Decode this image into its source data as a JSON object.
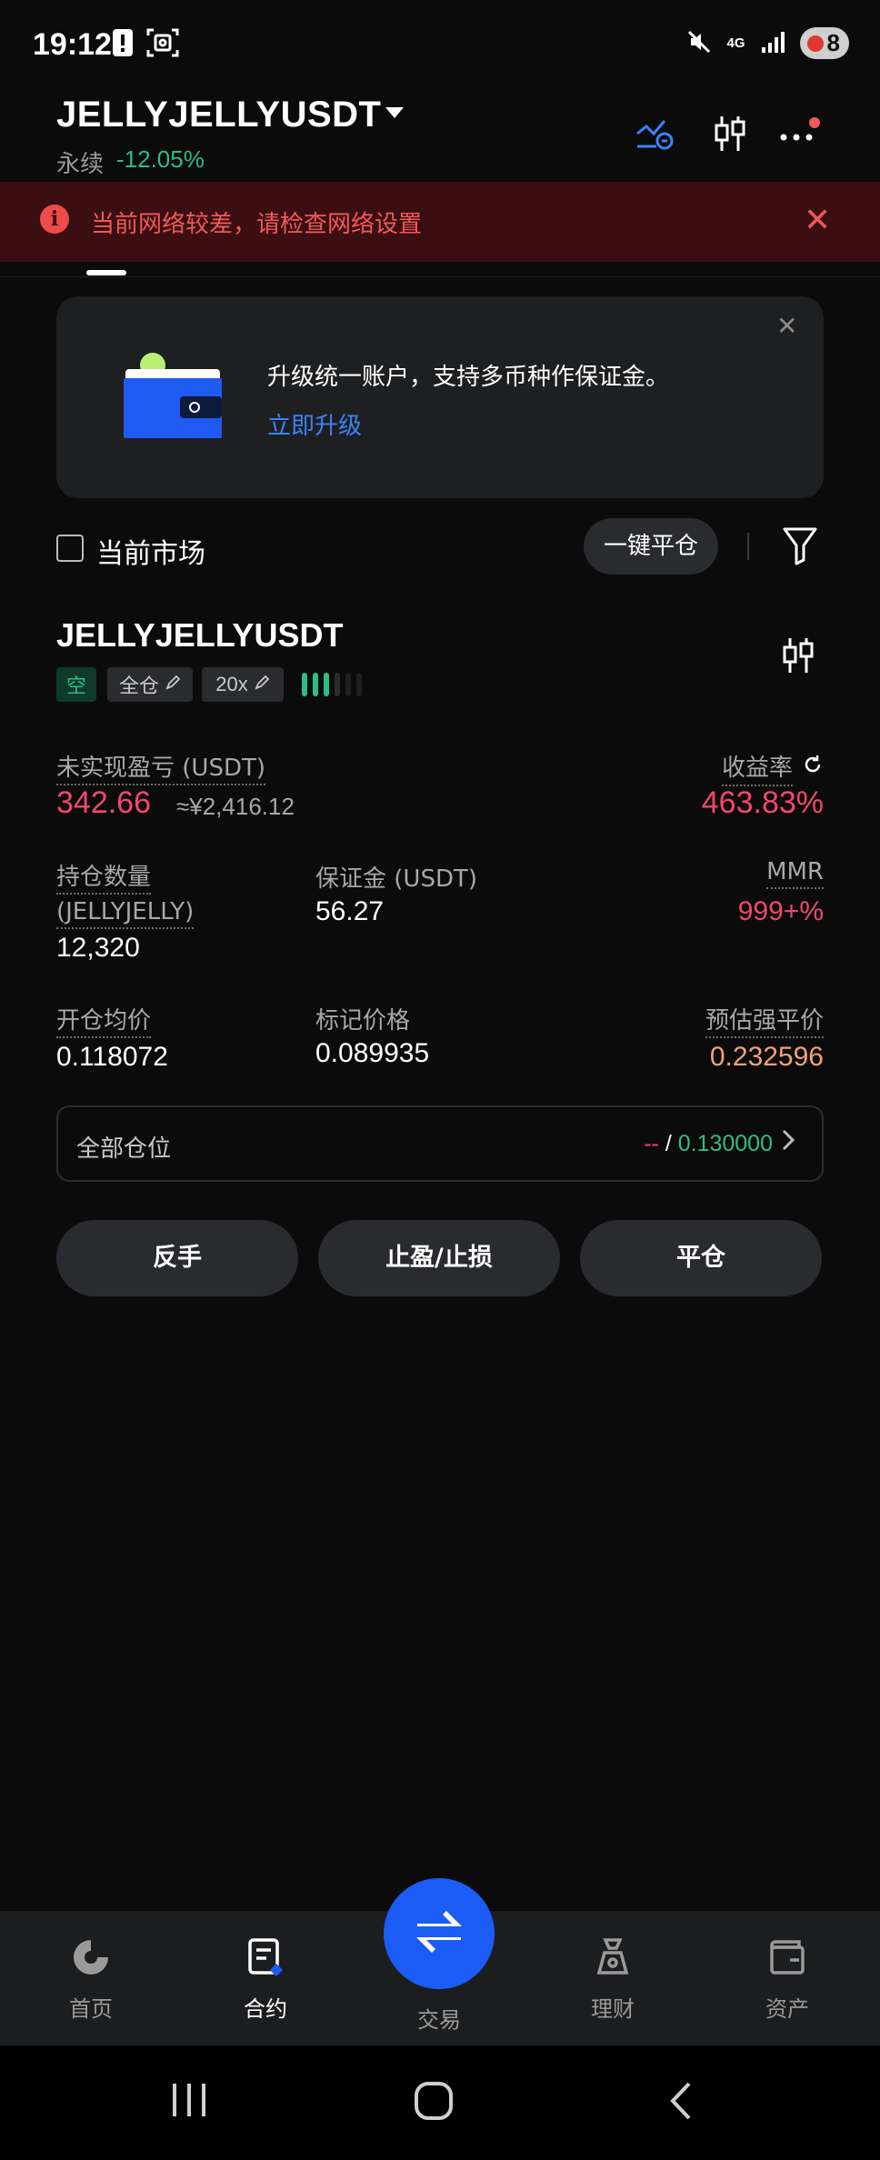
{
  "status_bar": {
    "time": "19:12",
    "signal_label": "4G",
    "battery": "8",
    "icons": [
      "alert-icon",
      "screenshot-icon",
      "mute-icon",
      "signal-icon",
      "battery-icon"
    ]
  },
  "header": {
    "pair": "JELLYJELLYUSDT",
    "contract_type": "永续",
    "change": "-12.05%",
    "icons": [
      "compare-chart-icon",
      "candlestick-icon",
      "more-icon"
    ]
  },
  "banner": {
    "text": "当前网络较差，请检查网络设置"
  },
  "upgrade_card": {
    "text": "升级统一账户，支持多币种作保证金。",
    "link": "立即升级"
  },
  "filter": {
    "current_market": "当前市场",
    "close_all": "一键平仓"
  },
  "position": {
    "name": "JELLYJELLYUSDT",
    "side": "空",
    "margin_mode": "全仓",
    "leverage": "20x",
    "risk_bars": {
      "total": 6,
      "filled": 3
    },
    "unrealized_pnl_label": "未实现盈亏 (USDT)",
    "unrealized_pnl": "342.66",
    "unrealized_pnl_cny": "≈¥2,416.12",
    "roe_label": "收益率",
    "roe": "463.83%",
    "qty_label_1": "持仓数量",
    "qty_label_2": "(JELLYJELLY)",
    "qty": "12,320",
    "margin_label": "保证金 (USDT)",
    "margin": "56.27",
    "mmr_label": "MMR",
    "mmr": "999+%",
    "entry_label": "开仓均价",
    "entry": "0.118072",
    "mark_label": "标记价格",
    "mark": "0.089935",
    "liq_label": "预估强平价",
    "liq": "0.232596",
    "all_positions_label": "全部仓位",
    "all_positions_left": "--",
    "all_positions_sep": "/",
    "all_positions_right": "0.130000"
  },
  "actions": {
    "reverse": "反手",
    "tp_sl": "止盈/止损",
    "close": "平仓"
  },
  "bottom_nav": {
    "home": "首页",
    "contract": "合约",
    "trade": "交易",
    "earn": "理财",
    "assets": "资产"
  },
  "colors": {
    "green": "#2ebd85",
    "red": "#f0476e",
    "orange": "#f3a274",
    "blue": "#1a5cf5",
    "link_blue": "#3b82f6",
    "banner_bg": "#3b0f12"
  }
}
